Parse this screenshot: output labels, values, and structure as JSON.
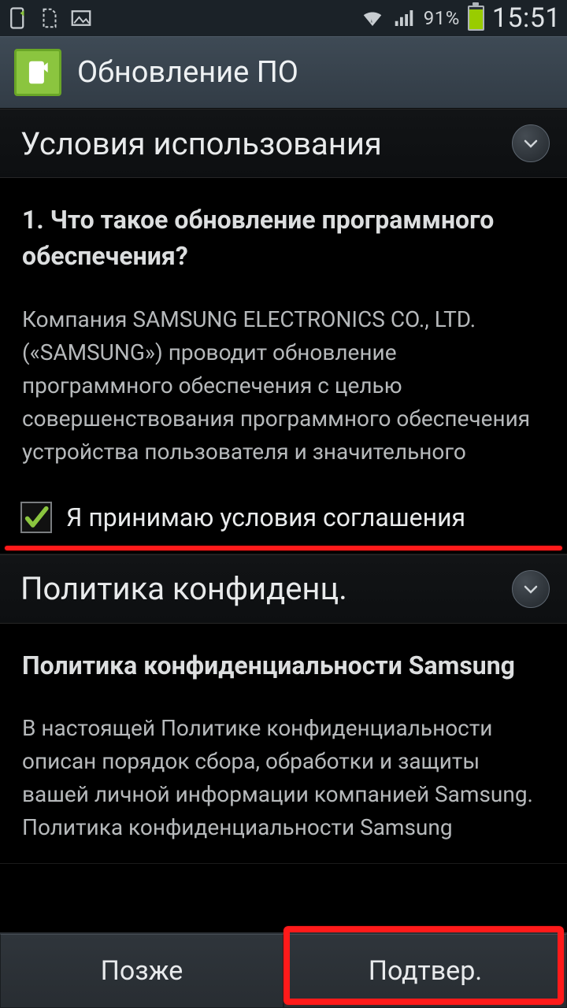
{
  "status": {
    "battery_pct": "91%",
    "clock": "15:51"
  },
  "title": "Обновление ПО",
  "section1": {
    "title": "Условия использования",
    "q_title": "1. Что такое обновление программного обеспечения?",
    "q_text": "Компания SAMSUNG ELECTRONICS CO., LTD. («SAMSUNG») проводит обновление программного обеспечения с целью совершенствования программного обеспечения устройства пользователя и значительного",
    "accept_label": "Я принимаю условия соглашения"
  },
  "section2": {
    "title": "Политика конфиденц.",
    "q_title": "Политика конфиденциальности Samsung",
    "q_text": "В настоящей Политике конфиденциальности описан порядок сбора, обработки и защиты вашей личной информации компанией Samsung. Политика конфиденциальности Samsung"
  },
  "buttons": {
    "later": "Позже",
    "confirm": "Подтвер."
  }
}
